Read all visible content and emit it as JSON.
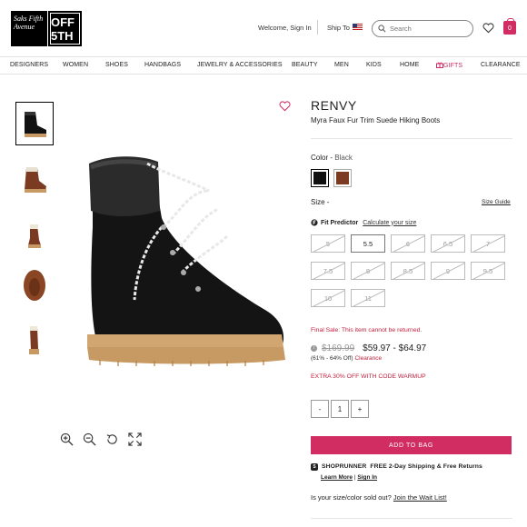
{
  "header": {
    "logo_saks": "Saks Fifth Avenue",
    "logo_off5th": "OFF 5TH",
    "welcome": "Welcome, Sign In",
    "ship_to": "Ship To",
    "search_placeholder": "Search",
    "bag_count": "0"
  },
  "nav": {
    "items": [
      "DESIGNERS",
      "WOMEN",
      "SHOES",
      "HANDBAGS",
      "JEWELRY & ACCESSORIES",
      "BEAUTY",
      "MEN",
      "KIDS",
      "HOME",
      "GIFTS",
      "CLEARANCE"
    ]
  },
  "product": {
    "brand": "RENVY",
    "name": "Myra Faux Fur Trim Suede Hiking Boots",
    "color_label": "Color -",
    "color_value": "Black",
    "size_label": "Size -",
    "size_guide": "Size Guide",
    "fit_predictor": "Fit Predictor",
    "fit_link": "Calculate your size",
    "sizes": [
      "5",
      "5.5",
      "6",
      "6.5",
      "7",
      "7.5",
      "8",
      "8.5",
      "9",
      "9.5",
      "10",
      "11"
    ],
    "final_sale": "Final Sale: This item cannot be returned.",
    "original_price": "$169.99",
    "sale_price": "$59.97 - $64.97",
    "discount": "(61% - 64% Off)",
    "clearance": "Clearance",
    "promo": "EXTRA 30% OFF WITH CODE WARMUP",
    "qty_minus": "-",
    "qty_value": "1",
    "qty_plus": "+",
    "add_to_bag": "ADD TO BAG",
    "shoprunner_brand": "SHOPRUNNER",
    "shoprunner_text": "FREE 2-Day Shipping & Free Returns",
    "learn_more": "Learn More",
    "sign_in": "Sign In",
    "waitlist_text": "Is your size/color sold out?",
    "waitlist_link": "Join the Wait List!"
  },
  "colors": {
    "accent": "#d12d63",
    "sale_red": "#c0203c",
    "swatch_black": "#111111",
    "swatch_brown": "#7a3b22"
  }
}
